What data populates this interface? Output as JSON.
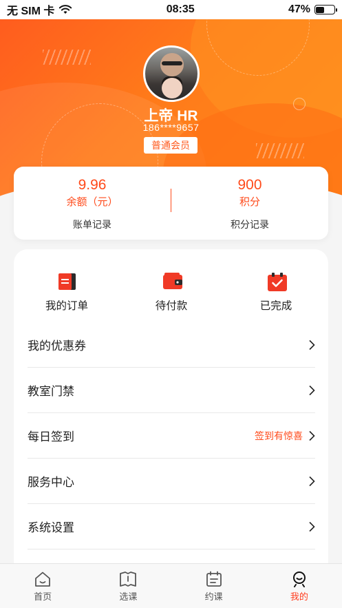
{
  "status_bar": {
    "carrier": "无 SIM 卡",
    "time": "08:35",
    "battery": "47%",
    "battery_level": 0.47
  },
  "profile": {
    "name": "上帝 HR",
    "phone": "186****9657",
    "member_level": "普通会员"
  },
  "balance": {
    "amount": "9.96",
    "amount_label": "余额（元）",
    "amount_link": "账单记录",
    "points": "900",
    "points_label": "积分",
    "points_link": "积分记录"
  },
  "orders": [
    {
      "label": "我的订单",
      "icon": "order-list-icon"
    },
    {
      "label": "待付款",
      "icon": "wallet-icon"
    },
    {
      "label": "已完成",
      "icon": "clipboard-check-icon"
    }
  ],
  "menu": [
    {
      "label": "我的优惠券",
      "hint": ""
    },
    {
      "label": "教室门禁",
      "hint": ""
    },
    {
      "label": "每日签到",
      "hint": "签到有惊喜"
    },
    {
      "label": "服务中心",
      "hint": ""
    },
    {
      "label": "系统设置",
      "hint": ""
    }
  ],
  "tabs": [
    {
      "label": "首页",
      "icon": "home-icon",
      "active": false
    },
    {
      "label": "选课",
      "icon": "book-icon",
      "active": false
    },
    {
      "label": "约课",
      "icon": "calendar-icon",
      "active": false
    },
    {
      "label": "我的",
      "icon": "profile-icon",
      "active": true
    }
  ],
  "colors": {
    "accent": "#ff4a1a",
    "header_gradient_start": "#ff5a1f",
    "header_gradient_end": "#ff8c1a"
  }
}
